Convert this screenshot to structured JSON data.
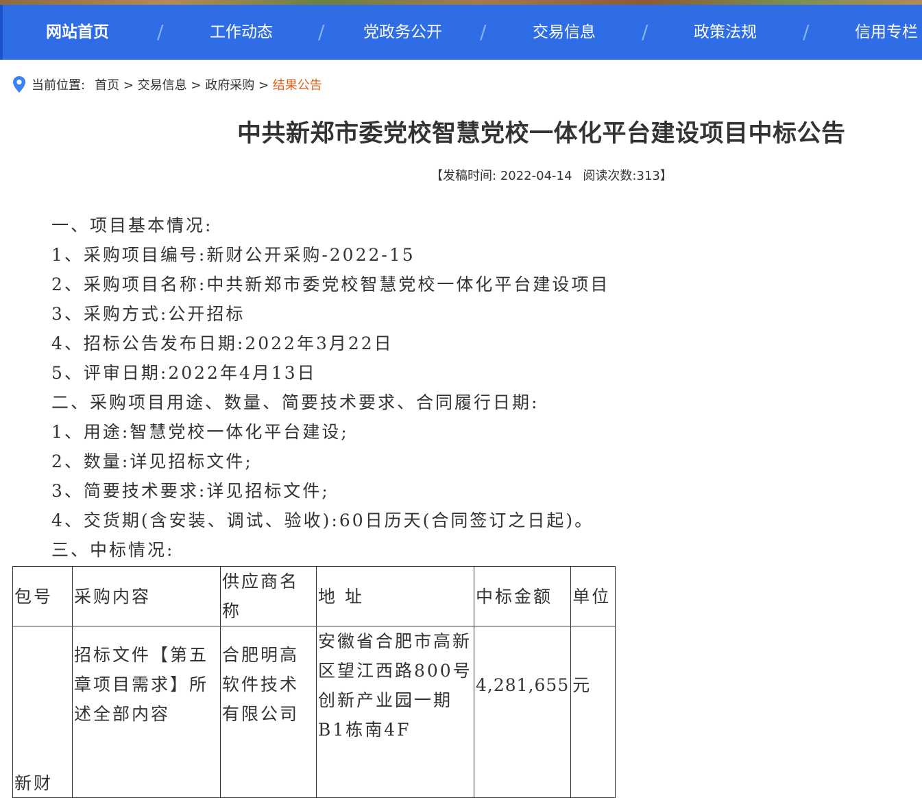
{
  "nav": {
    "items": [
      {
        "label": "网站首页",
        "active": true
      },
      {
        "label": "工作动态",
        "active": false
      },
      {
        "label": "党政务公开",
        "active": false
      },
      {
        "label": "交易信息",
        "active": false
      },
      {
        "label": "政策法规",
        "active": false
      },
      {
        "label": "信用专栏",
        "active": false
      }
    ],
    "separator": "/"
  },
  "breadcrumb": {
    "label": "当前位置:",
    "items": [
      "首页",
      "交易信息",
      "政府采购"
    ],
    "separator": ">",
    "current": "结果公告"
  },
  "article": {
    "title": "中共新郑市委党校智慧党校一体化平台建设项目中标公告",
    "meta": {
      "open": "【",
      "publish_label": "发稿时间:",
      "publish_date": "2022-04-14",
      "views_label": "阅读次数:",
      "views": "313",
      "close": "】"
    },
    "paragraphs": [
      "一、项目基本情况:",
      "1、采购项目编号:新财公开采购-2022-15",
      "2、采购项目名称:中共新郑市委党校智慧党校一体化平台建设项目",
      "3、采购方式:公开招标",
      "4、招标公告发布日期:2022年3月22日",
      "5、评审日期:2022年4月13日",
      "二、采购项目用途、数量、简要技术要求、合同履行日期:",
      "1、用途:智慧党校一体化平台建设;",
      "2、数量:详见招标文件;",
      "3、简要技术要求:详见招标文件;",
      "4、交货期(含安装、调试、验收):60日历天(合同签订之日起)。",
      "三、中标情况:"
    ]
  },
  "table": {
    "headers": [
      "包号",
      "采购内容",
      "供应商名称",
      "地 址",
      "中标金额",
      "单位"
    ],
    "rows": [
      {
        "package": "新财公",
        "content": "招标文件【第五章项目需求】所述全部内容",
        "supplier": "合肥明高软件技术有限公司",
        "address": "安徽省合肥市高新区望江西路800号创新产业园一期B1栋南4F",
        "amount": "4,281,655",
        "unit": "元"
      }
    ]
  },
  "colors": {
    "nav_bg": "#2f6de6",
    "accent_orange": "#e5621a",
    "pin_blue": "#3b82f6",
    "text": "#333333"
  }
}
